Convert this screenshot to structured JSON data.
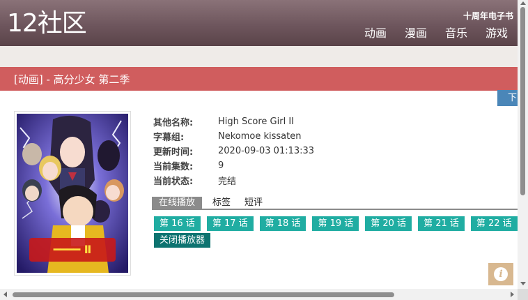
{
  "header": {
    "logo": "12社区",
    "promo": "十周年电子书",
    "nav": [
      "动画",
      "漫画",
      "音乐",
      "游戏"
    ]
  },
  "title_bar": {
    "title": "[动画] - 高分少女 第二季"
  },
  "side_tab": {
    "label": "下"
  },
  "info": [
    {
      "key": "其他名称:",
      "value": "High Score Girl II"
    },
    {
      "key": "字幕组:",
      "value": "Nekomoe kissaten"
    },
    {
      "key": "更新时间:",
      "value": "2020-09-03 01:13:33"
    },
    {
      "key": "当前集数:",
      "value": "9"
    },
    {
      "key": "当前状态:",
      "value": "完结"
    }
  ],
  "tabs": [
    "在线播放",
    "标签",
    "短评"
  ],
  "episodes": [
    "第 16 话",
    "第 17 话",
    "第 18 话",
    "第 19 话",
    "第 20 话",
    "第 21 话",
    "第 22 话"
  ],
  "close_player": "关闭播放器",
  "info_button": {
    "glyph": "i"
  },
  "colors": {
    "header": "#6e565d",
    "title_bar": "#d05d5e",
    "episode": "#20ada2",
    "close_player": "#0d7370",
    "tab_active": "#8b8b8b",
    "side_tab": "#4a86b8",
    "info_button": "#d8b890"
  }
}
